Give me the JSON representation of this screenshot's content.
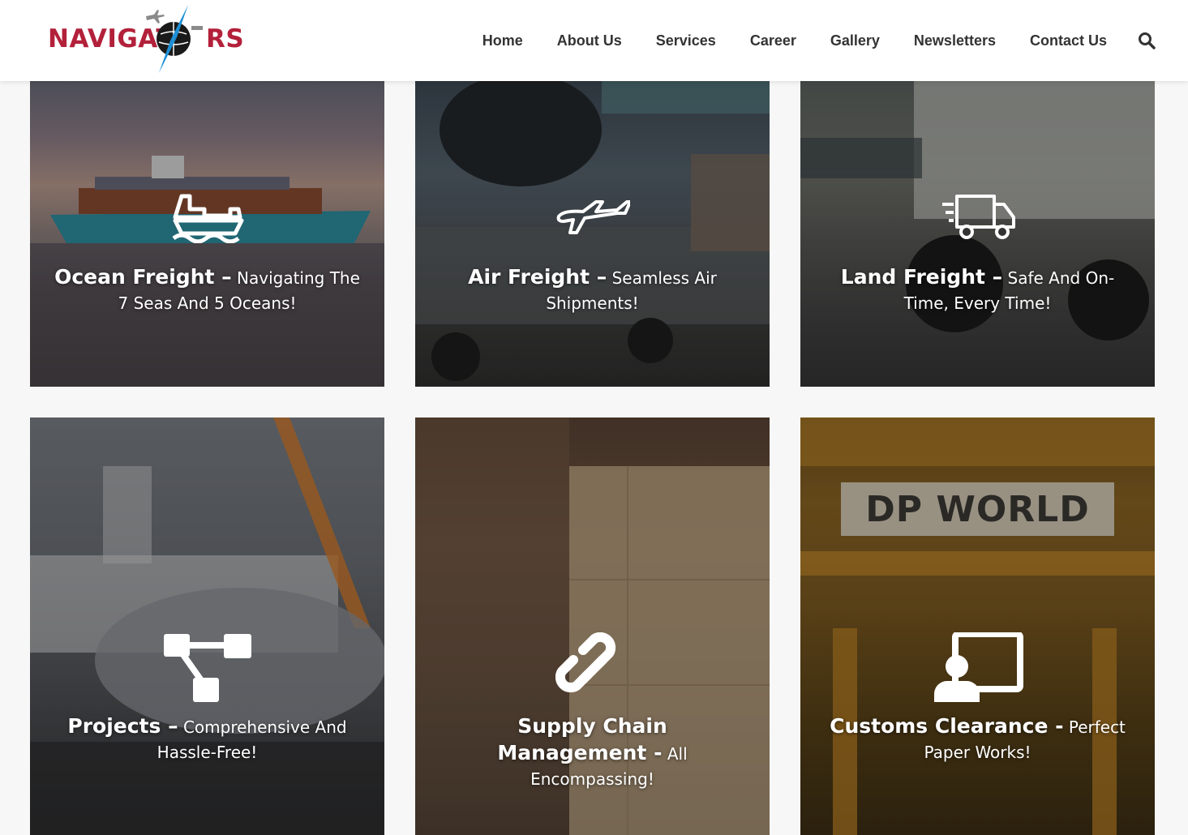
{
  "header": {
    "logo": {
      "text_left": "NAVIGAT",
      "text_right": "RS",
      "brand_color": "#b3203a",
      "accent_color": "#1e90d6"
    },
    "nav": [
      {
        "label": "Home"
      },
      {
        "label": "About Us"
      },
      {
        "label": "Services"
      },
      {
        "label": "Career"
      },
      {
        "label": "Gallery"
      },
      {
        "label": "Newsletters"
      },
      {
        "label": "Contact Us"
      }
    ],
    "search_icon": "search-icon"
  },
  "services": [
    {
      "title": "Ocean Freight –",
      "subtitle": "Navigating The 7 Seas And 5 Oceans!",
      "icon": "ship-icon"
    },
    {
      "title": "Air Freight –",
      "subtitle": "Seamless Air Shipments!",
      "icon": "airplane-icon"
    },
    {
      "title": "Land Freight –",
      "subtitle": "Safe And On-Time, Every Time!",
      "icon": "truck-icon"
    },
    {
      "title": "Projects –",
      "subtitle": "Comprehensive And Hassle-Free!",
      "icon": "sitemap-icon"
    },
    {
      "title": "Supply Chain Management -",
      "subtitle": "All Encompassing!",
      "icon": "link-icon"
    },
    {
      "title": "Customs Clearance -",
      "subtitle": "Perfect Paper Works!",
      "icon": "presenter-icon"
    }
  ],
  "scene_text": {
    "customs_banner": "DP WORLD"
  }
}
